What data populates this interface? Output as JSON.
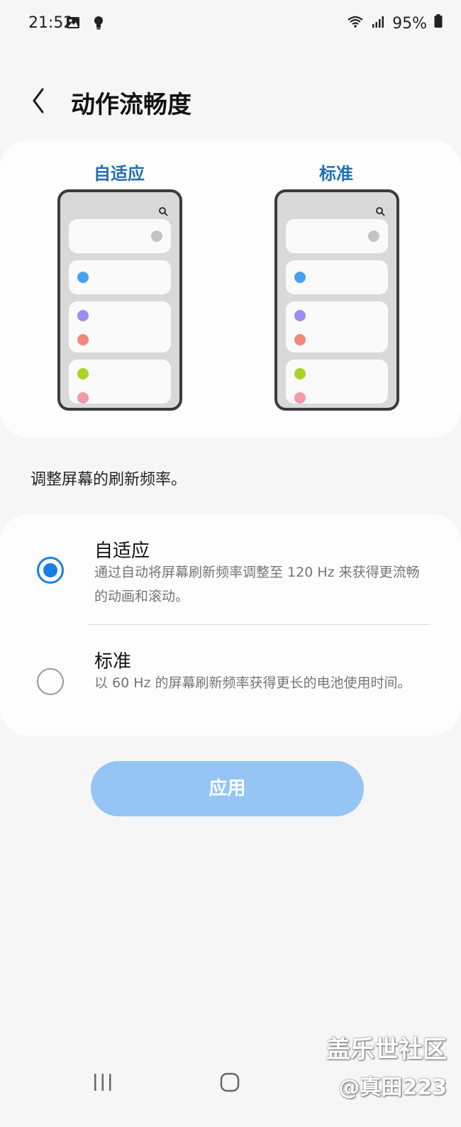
{
  "status_bar": {
    "time": "21:52",
    "icons": [
      "image-icon",
      "bulb-icon"
    ],
    "right_icons": [
      "wifi-icon",
      "signal-icon",
      "battery-icon"
    ],
    "battery": "95%"
  },
  "header": {
    "back_icon": "chevron-left-icon",
    "title": "动作流畅度"
  },
  "preview": {
    "adaptive_label": "自适应",
    "standard_label": "标准",
    "dot_colors": {
      "gray": "#c4c4c4",
      "blue": "#4aa0f0",
      "purple": "#a18af0",
      "coral": "#f2887c",
      "green": "#a8d42a",
      "pink": "#f29aa6"
    }
  },
  "description": "调整屏幕的刷新频率。",
  "options": [
    {
      "title": "自适应",
      "subtitle": "通过自动将屏幕刷新频率调整至 120 Hz 来获得更流畅的动画和滚动。",
      "selected": true
    },
    {
      "title": "标准",
      "subtitle": "以 60 Hz 的屏幕刷新频率获得更长的电池使用时间。",
      "selected": false
    }
  ],
  "apply_button": "应用",
  "nav": {
    "recents_icon": "recents-icon",
    "home_icon": "home-icon"
  },
  "watermark": {
    "line1": "盖乐世社区",
    "line2": "@真田223"
  },
  "colors": {
    "accent": "#1a7fe0",
    "preview_label": "#1f6fb5",
    "apply_bg": "#94c5f5"
  }
}
